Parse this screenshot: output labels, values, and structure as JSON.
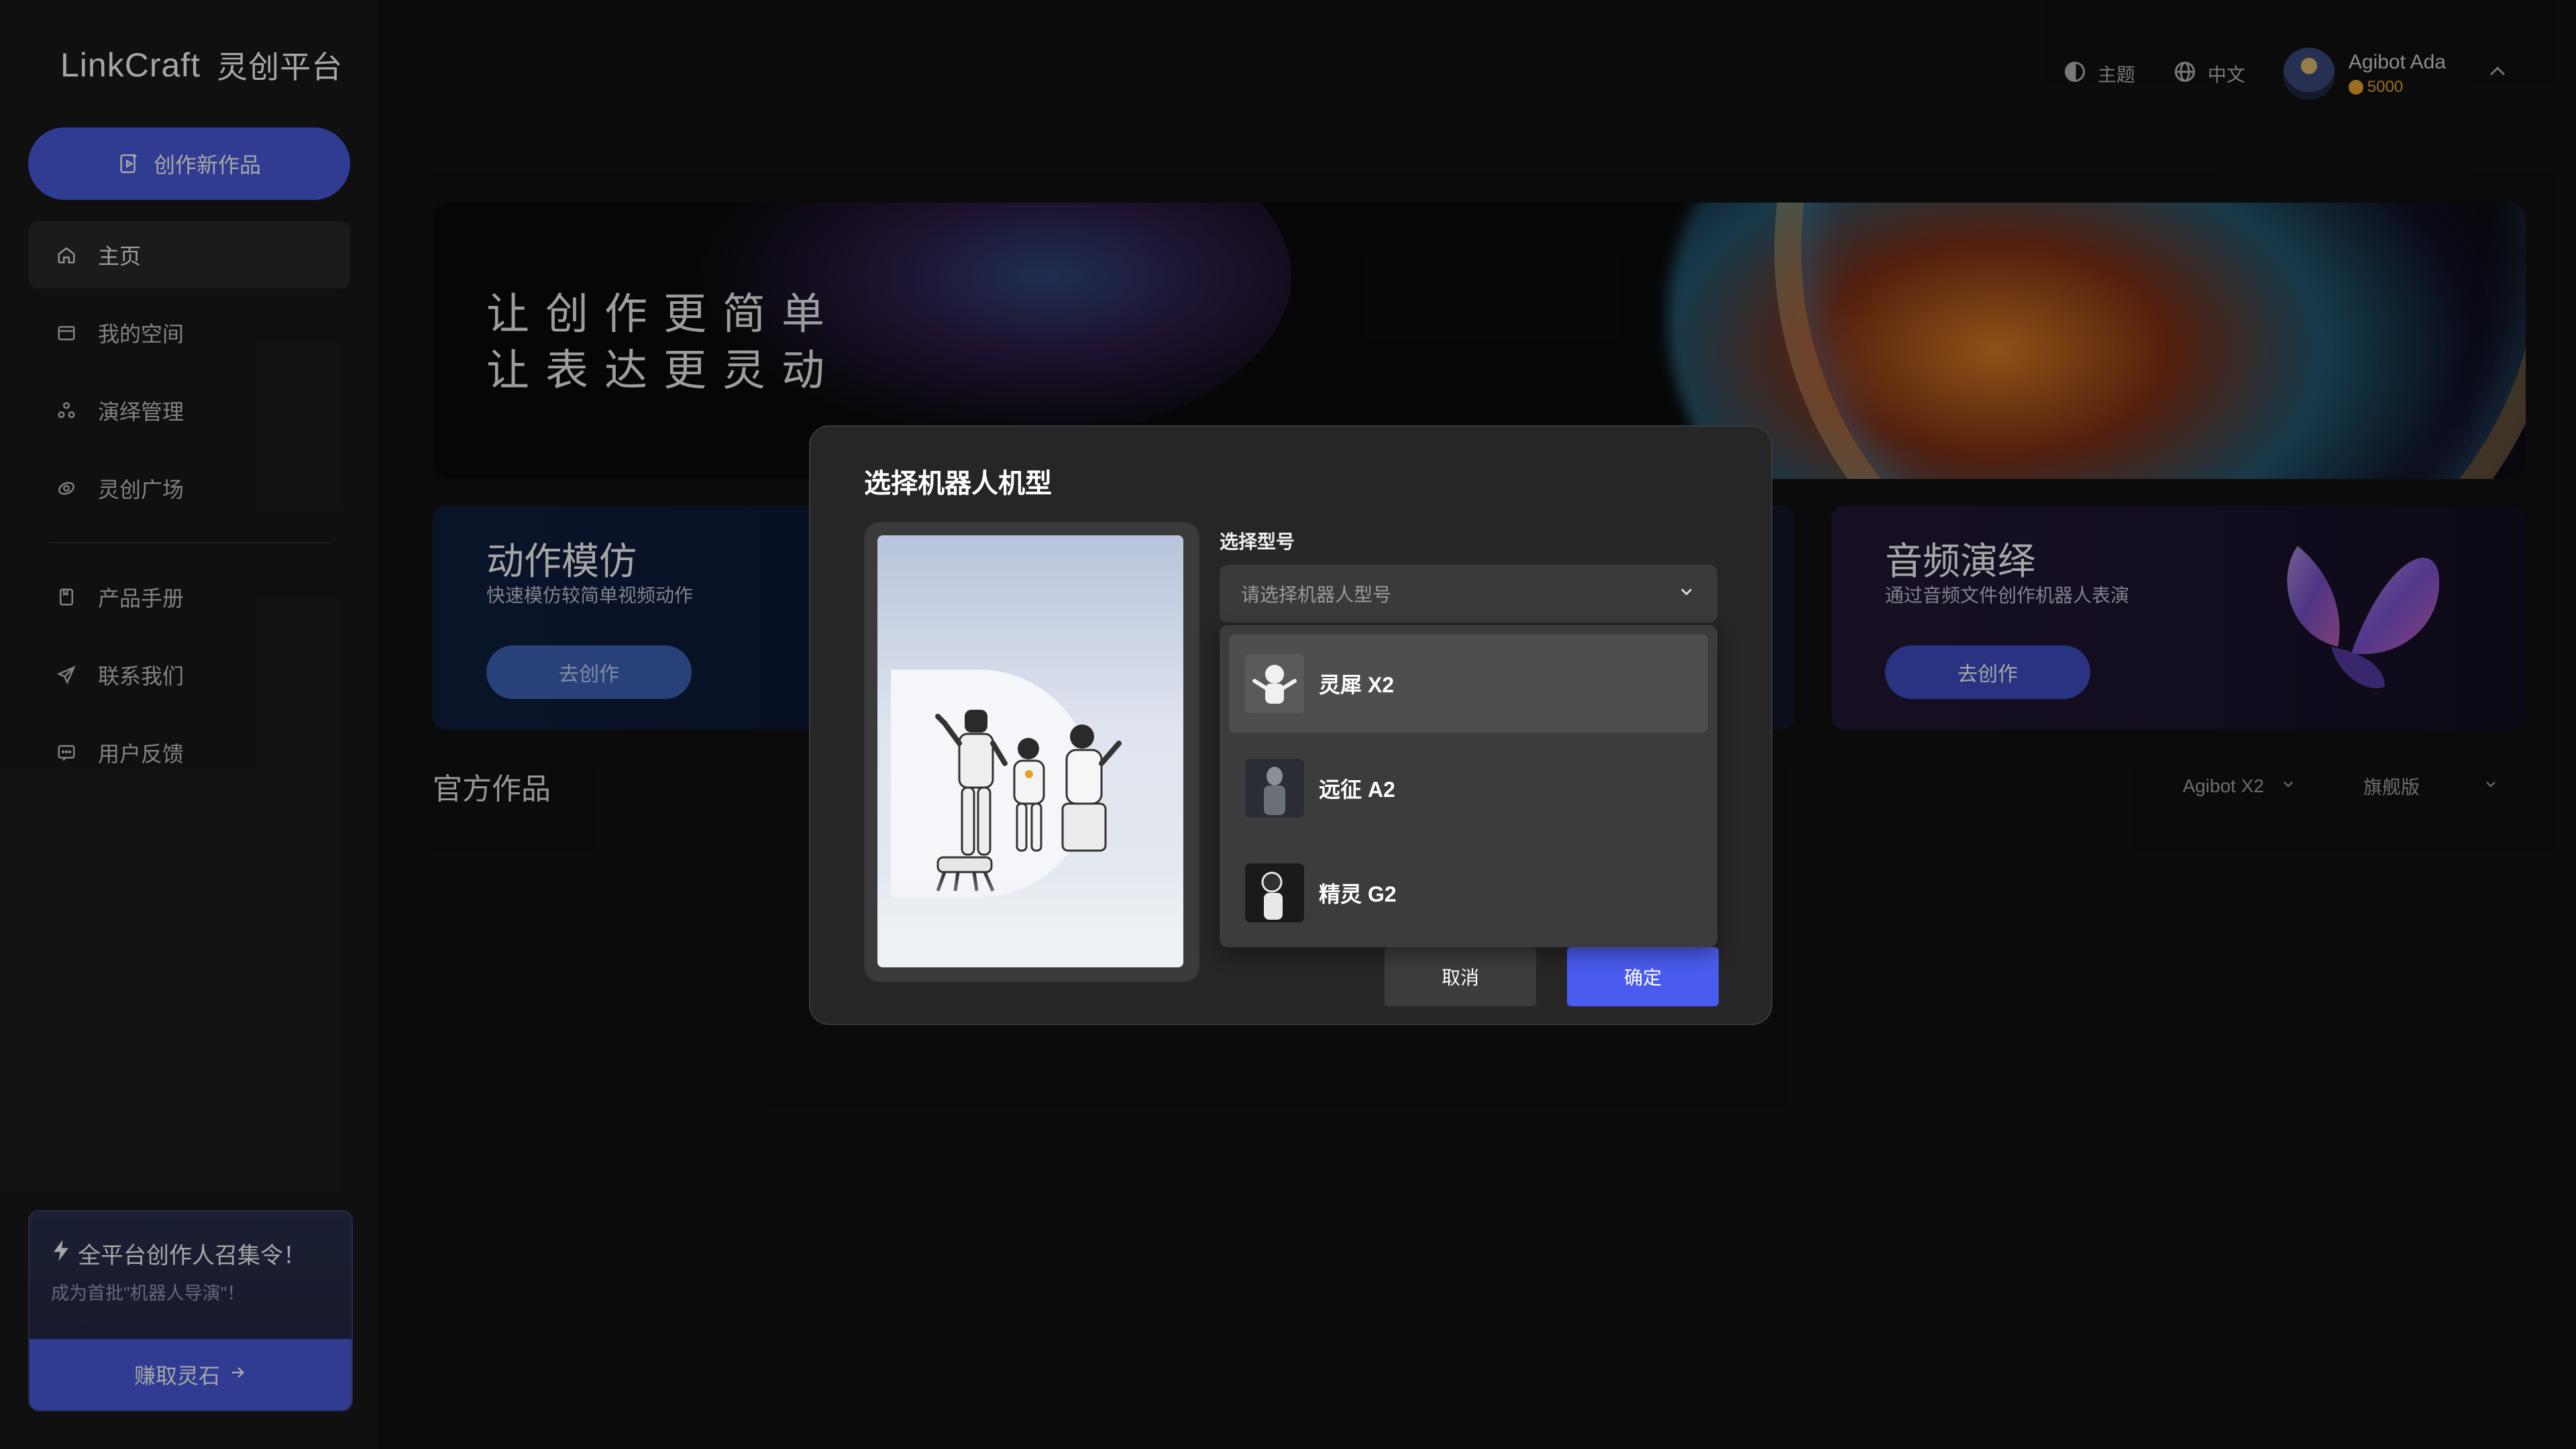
{
  "app": {
    "logo_text": "LinkCraft",
    "logo_cn": "灵创平台"
  },
  "sidebar": {
    "create_label": "创作新作品",
    "items": [
      {
        "label": "主页",
        "icon": "home-icon"
      },
      {
        "label": "我的空间",
        "icon": "folder-icon"
      },
      {
        "label": "演绎管理",
        "icon": "perform-icon"
      },
      {
        "label": "灵创广场",
        "icon": "plaza-icon"
      },
      {
        "label": "产品手册",
        "icon": "book-icon"
      },
      {
        "label": "联系我们",
        "icon": "send-icon"
      },
      {
        "label": "用户反馈",
        "icon": "feedback-icon"
      }
    ],
    "promo": {
      "title": "全平台创作人召集令！",
      "subtitle": "成为首批\"机器人导演\"！",
      "button": "赚取灵石"
    }
  },
  "topbar": {
    "theme_label": "主题",
    "lang_label": "中文",
    "user_name": "Agibot Ada",
    "user_coins": "5000"
  },
  "banner": {
    "line1": "让创作更简单",
    "line2": "让表达更灵动"
  },
  "cards": {
    "motion": {
      "title": "动作模仿",
      "subtitle": "快速模仿较简单视频动作",
      "button": "去创作"
    },
    "audio": {
      "title": "音频演绎",
      "subtitle": "通过音频文件创作机器人表演",
      "button": "去创作"
    }
  },
  "section": {
    "title": "官方作品",
    "filter_model": "Agibot X2",
    "filter_edition": "旗舰版"
  },
  "modal": {
    "title": "选择机器人机型",
    "field_label": "选择型号",
    "select_placeholder": "请选择机器人型号",
    "options": [
      {
        "label": "灵犀 X2"
      },
      {
        "label": "远征 A2"
      },
      {
        "label": "精灵 G2"
      }
    ],
    "cancel_label": "取消",
    "ok_label": "确定"
  },
  "colors": {
    "accent": "#4a5ce0",
    "confirm": "#4a5cf0",
    "coin": "#f0a830"
  }
}
